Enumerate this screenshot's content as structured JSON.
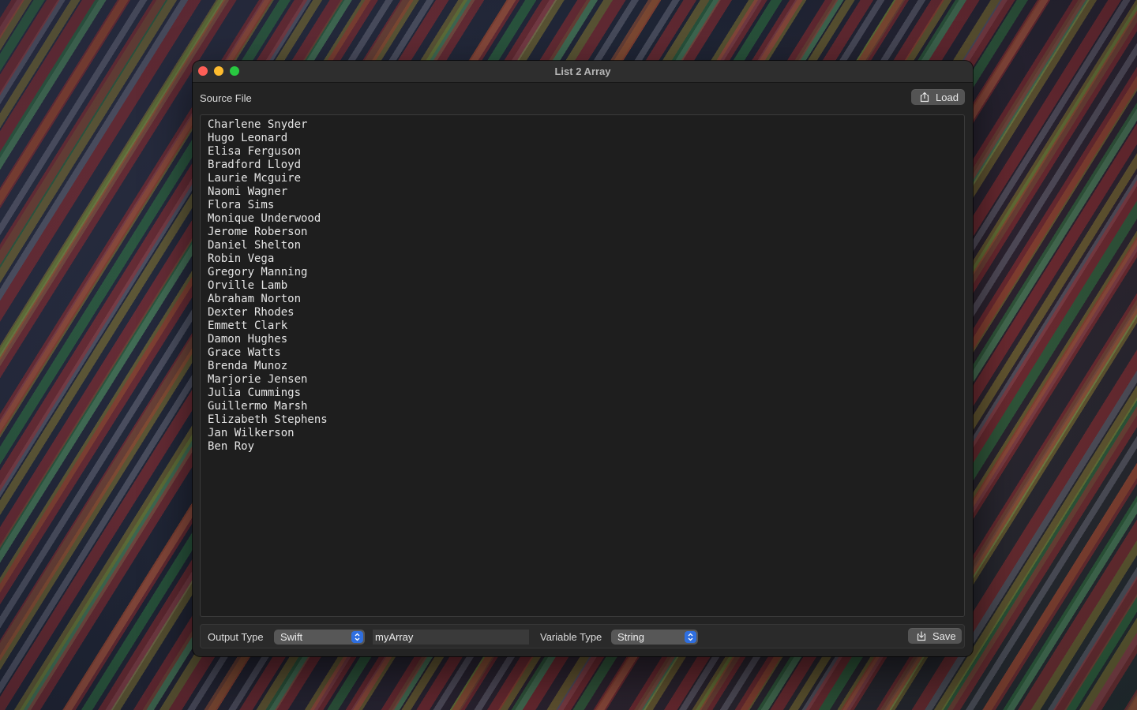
{
  "window": {
    "title": "List 2 Array"
  },
  "source": {
    "label": "Source File",
    "load_label": "Load",
    "lines": [
      "Charlene Snyder",
      "Hugo Leonard",
      "Elisa Ferguson",
      "Bradford Lloyd",
      "Laurie Mcguire",
      "Naomi Wagner",
      "Flora Sims",
      "Monique Underwood",
      "Jerome Roberson",
      "Daniel Shelton",
      "Robin Vega",
      "Gregory Manning",
      "Orville Lamb",
      "Abraham Norton",
      "Dexter Rhodes",
      "Emmett Clark",
      "Damon Hughes",
      "Grace Watts",
      "Brenda Munoz",
      "Marjorie Jensen",
      "Julia Cummings",
      "Guillermo Marsh",
      "Elizabeth Stephens",
      "Jan Wilkerson",
      "Ben Roy"
    ]
  },
  "bottom": {
    "output_type_label": "Output Type",
    "output_type_value": "Swift",
    "array_name_value": "myArray",
    "variable_type_label": "Variable Type",
    "variable_type_value": "String",
    "save_label": "Save"
  },
  "icons": {
    "traffic_lights": [
      "close-icon",
      "minimize-icon",
      "zoom-icon"
    ],
    "load": "share-up-icon",
    "save": "share-down-icon",
    "popup": "chevron-updown-icon"
  },
  "colors": {
    "close": "#fe5f57",
    "minimize": "#febc2e",
    "zoom": "#28c840",
    "accent": "#2f6fe0",
    "window_bg": "#232323",
    "editor_bg": "#1e1e1e"
  }
}
